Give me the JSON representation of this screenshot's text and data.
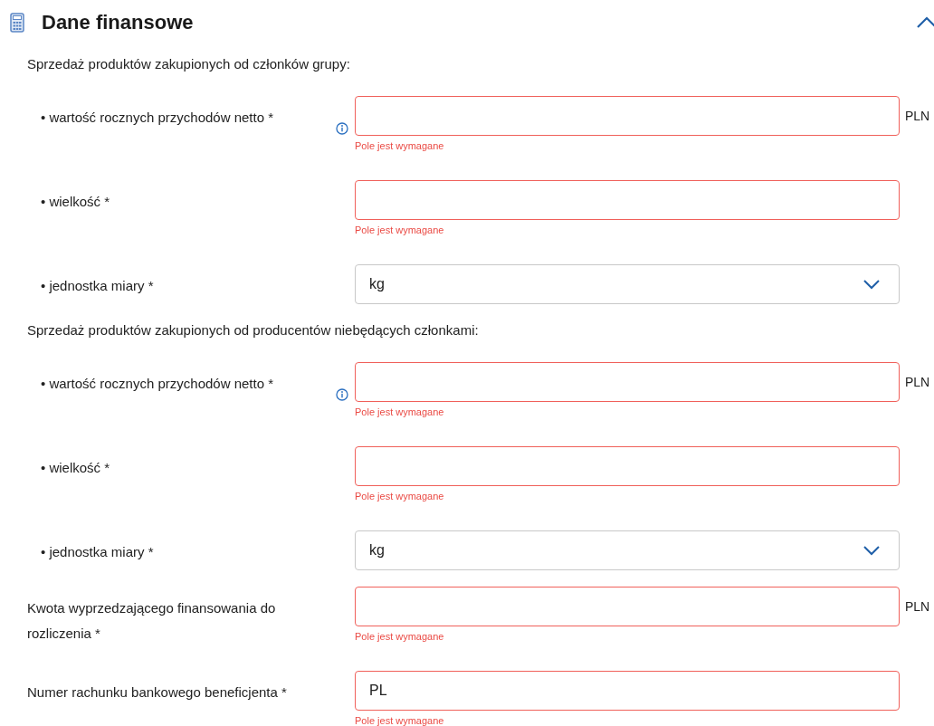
{
  "section": {
    "title": "Dane finansowe",
    "expanded": true
  },
  "rows": [
    {
      "kind": "group",
      "label": "Sprzedaż produktów zakupionych od członków grupy:",
      "children": [
        {
          "kind": "input",
          "label": "• wartość rocznych przychodów netto  *",
          "info": true,
          "invalid": true,
          "error": "Pole jest wymagane",
          "unit": "PLN"
        },
        {
          "kind": "input",
          "label": "• wielkość  *",
          "info": false,
          "invalid": true,
          "error": "Pole jest wymagane"
        },
        {
          "kind": "select",
          "label": "• jednostka miary *",
          "value": "kg",
          "invalid": false
        }
      ]
    },
    {
      "kind": "group",
      "label": "Sprzedaż produktów zakupionych od producentów niebędących członkami:",
      "children": [
        {
          "kind": "input",
          "label": "• wartość rocznych przychodów netto  *",
          "info": true,
          "invalid": true,
          "error": "Pole jest wymagane",
          "unit": "PLN"
        },
        {
          "kind": "input",
          "label": "• wielkość  *",
          "info": false,
          "invalid": true,
          "error": "Pole jest wymagane"
        },
        {
          "kind": "select",
          "label": "• jednostka miary *",
          "value": "kg",
          "invalid": false
        }
      ]
    },
    {
      "kind": "input",
      "label": "Kwota wyprzedzającego finansowania do rozliczenia  *",
      "info": false,
      "invalid": true,
      "error": "Pole jest wymagane",
      "unit": "PLN"
    },
    {
      "kind": "input",
      "label": "Numer rachunku bankowego beneficjenta  *",
      "info": false,
      "invalid": true,
      "value": "PL",
      "error": "Pole jest wymagane"
    }
  ]
}
